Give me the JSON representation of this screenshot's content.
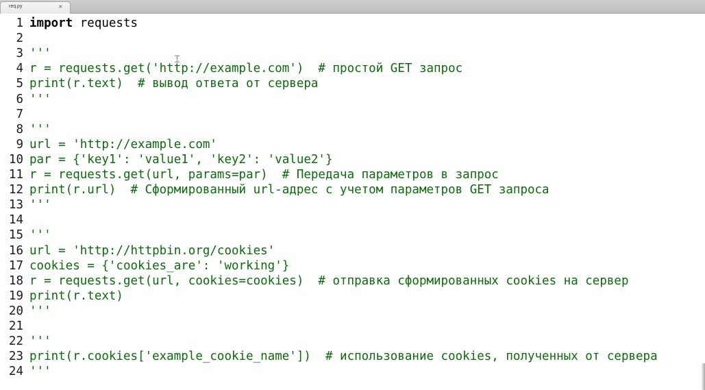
{
  "tab": {
    "filename": "req.py",
    "close_glyph": "×"
  },
  "editor": {
    "line_numbers": [
      "1",
      "2",
      "3",
      "4",
      "5",
      "6",
      "7",
      "8",
      "9",
      "10",
      "11",
      "12",
      "13",
      "14",
      "15",
      "16",
      "17",
      "18",
      "19",
      "20",
      "21",
      "22",
      "23",
      "24"
    ],
    "lines": [
      [
        {
          "t": "import",
          "c": "kw"
        },
        {
          "t": " requests",
          "c": "tx"
        }
      ],
      [],
      [
        {
          "t": "'''",
          "c": "gr"
        }
      ],
      [
        {
          "t": "r = requests.get('http://example.com')  # простой GET запрос",
          "c": "gr"
        }
      ],
      [
        {
          "t": "print(r.text)  # вывод ответа от сервера",
          "c": "gr"
        }
      ],
      [
        {
          "t": "'''",
          "c": "gr"
        }
      ],
      [],
      [
        {
          "t": "'''",
          "c": "gr"
        }
      ],
      [
        {
          "t": "url = 'http://example.com'",
          "c": "gr"
        }
      ],
      [
        {
          "t": "par = {'key1': 'value1', 'key2': 'value2'}",
          "c": "gr"
        }
      ],
      [
        {
          "t": "r = requests.get(url, params=par)  # Передача параметров в запрос",
          "c": "gr"
        }
      ],
      [
        {
          "t": "print(r.url)  # Сформированный url-адрес с учетом параметров GET запроса",
          "c": "gr"
        }
      ],
      [
        {
          "t": "'''",
          "c": "gr"
        }
      ],
      [],
      [
        {
          "t": "'''",
          "c": "gr"
        }
      ],
      [
        {
          "t": "url = 'http://httpbin.org/cookies'",
          "c": "gr"
        }
      ],
      [
        {
          "t": "cookies = {'cookies_are': 'working'}",
          "c": "gr"
        }
      ],
      [
        {
          "t": "r = requests.get(url, cookies=cookies)  # отправка сформированных cookies на сервер",
          "c": "gr"
        }
      ],
      [
        {
          "t": "print(r.text)",
          "c": "gr"
        }
      ],
      [
        {
          "t": "'''",
          "c": "gr"
        }
      ],
      [],
      [
        {
          "t": "'''",
          "c": "gr"
        }
      ],
      [
        {
          "t": "print(r.cookies['example_cookie_name'])  # использование cookies, полученных от сервера",
          "c": "gr"
        }
      ],
      [
        {
          "t": "'''",
          "c": "gr"
        }
      ]
    ]
  },
  "colors": {
    "keyword": "#000000",
    "plain_text": "#000000",
    "string_block": "#0b6b0b",
    "line_number": "#1a1a1a",
    "background": "#ffffff"
  }
}
